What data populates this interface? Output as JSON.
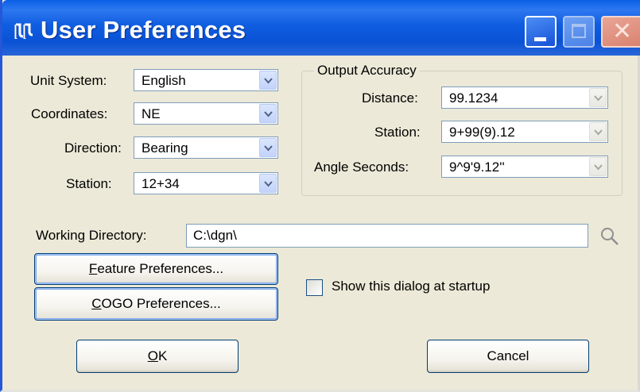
{
  "window": {
    "title": "User Preferences",
    "controls": {
      "minimize": "minimize",
      "maximize": "maximize",
      "close": "close"
    }
  },
  "units": {
    "unit_system": {
      "label": "Unit System:",
      "value": "English"
    },
    "coordinates": {
      "label": "Coordinates:",
      "value": "NE"
    },
    "direction": {
      "label": "Direction:",
      "value": "Bearing"
    },
    "station": {
      "label": "Station:",
      "value": "12+34"
    }
  },
  "output_accuracy": {
    "legend": "Output Accuracy",
    "distance": {
      "label": "Distance:",
      "value": "99.1234"
    },
    "station": {
      "label": "Station:",
      "value": "9+99(9).12"
    },
    "angle_seconds": {
      "label": "Angle Seconds:",
      "value": "9^9'9.12''"
    }
  },
  "working_directory": {
    "label": "Working Directory:",
    "value": "C:\\dgn\\"
  },
  "buttons": {
    "feature_prefs_mnemonic": "F",
    "feature_prefs_rest": "eature Preferences...",
    "cogo_prefs_mnemonic": "C",
    "cogo_prefs_rest": "OGO Preferences...",
    "ok_mnemonic": "O",
    "ok_rest": "K",
    "cancel": "Cancel"
  },
  "startup_checkbox": {
    "label": "Show this dialog at startup",
    "checked": false
  },
  "colors": {
    "titlebar": "#0a52d6",
    "dialog_bg": "#ece9d8",
    "button_border": "#003c74"
  },
  "icons": [
    "app-icon",
    "minimize-icon",
    "maximize-icon",
    "close-icon",
    "chevron-down-icon",
    "search-icon"
  ]
}
